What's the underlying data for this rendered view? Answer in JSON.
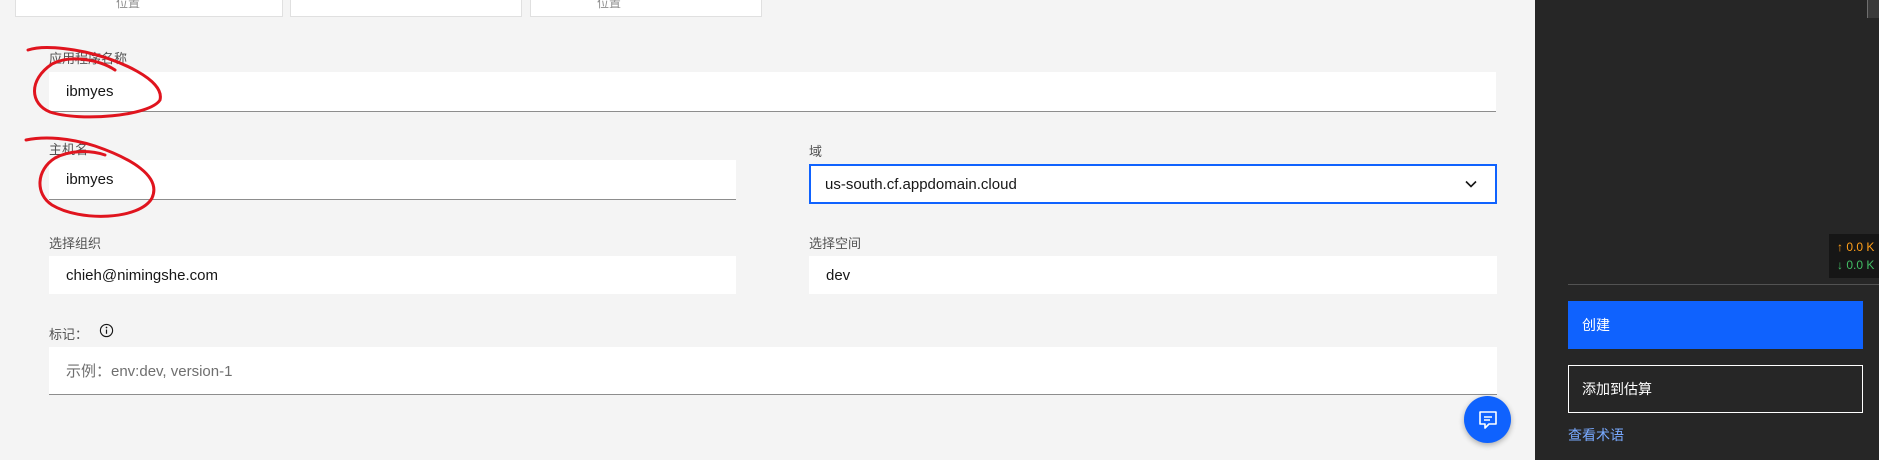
{
  "form": {
    "top_cards": [
      "位置",
      "",
      "位置"
    ],
    "app_name_label": "应用程序名称",
    "app_name_value": "ibmyes",
    "hostname_label": "主机名",
    "hostname_value": "ibmyes",
    "domain_label": "域",
    "domain_value": "us-south.cf.appdomain.cloud",
    "org_label": "选择组织",
    "org_value": "chieh@nimingshe.com",
    "space_label": "选择空间",
    "space_value": "dev",
    "tags_label": "标记：",
    "tags_placeholder": "示例：env:dev, version-1"
  },
  "sidebar": {
    "net_up": "↑ 0.0 K",
    "net_down": "↓ 0.0 K",
    "create_label": "创建",
    "add_estimate_label": "添加到估算",
    "terms_link": "查看术语"
  },
  "colors": {
    "primary": "#0f62fe",
    "annotation": "#e0141e",
    "sidebar_bg": "#262626",
    "link": "#78a9ff",
    "net_up": "#ff9f1a",
    "net_down": "#42be65"
  },
  "icons": {
    "info": "info-icon",
    "chevron": "chevron-down-icon",
    "chat": "chat-icon"
  }
}
